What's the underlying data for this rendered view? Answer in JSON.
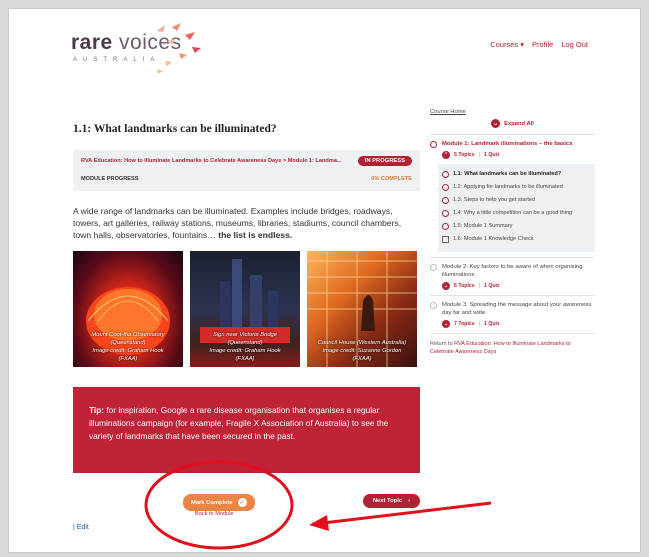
{
  "header": {
    "logo_word_bold": "rare",
    "logo_word": "voices",
    "logo_sub": "AUSTRALIA",
    "nav": {
      "courses": "Courses ▾",
      "profile": "Profile",
      "logout": "Log Out"
    }
  },
  "lesson": {
    "title": "1.1: What landmarks can be illuminated?",
    "breadcrumb": "RVA Education: How to Illuminate Landmarks to Celebrate Awareness Days > Module 1: Landma...",
    "status": "IN PROGRESS",
    "progress_label": "MODULE PROGRESS",
    "progress_value": "0% COMPLETE",
    "intro": "A wide range of landmarks can be illuminated. Examples include bridges, roadways, towers, art galleries, railway stations, museums, libraries, stadiums, council chambers, town halls, observatories, fountains…",
    "intro_bold": "the list is endless.",
    "photos": [
      {
        "caption_line1": "Mount Coot-tha Observatory",
        "caption_line2": "(Queensland)",
        "caption_line3": "Image credit: Graham Hook",
        "caption_line4": "(FXAA)"
      },
      {
        "caption_line1": "Sign near Victoria Bridge",
        "caption_line2": "(Queensland)",
        "caption_line3": "Image credit: Graham Hook",
        "caption_line4": "(FXAA)"
      },
      {
        "caption_line1": "Council House (Western Australia)",
        "caption_line2": "Image credit: Suzanne Gordon",
        "caption_line3": "(FXAA)",
        "caption_line4": ""
      }
    ],
    "tip_label": "Tip:",
    "tip_text": "for inspiration, Google a rare disease organisation that organises a regular illuminations campaign (for example, Fragile X Association of Australia) to see the variety of landmarks that have been secured in the past.",
    "mark_complete": "Mark Complete",
    "back_to_module": "Back to Module",
    "next_topic": "Next Topic",
    "edit": "| Edit"
  },
  "sidebar": {
    "course_home": "Course Home",
    "expand_all": "Expand All",
    "modules": [
      {
        "title": "Module 1: Landmark illuminations – the basics",
        "topics": "5 Topics",
        "quiz": "1 Quiz",
        "lessons": [
          "1.1: What landmarks can be illuminated?",
          "1.2: Applying for landmarks to be illuminated",
          "1.3: Steps to help you get started",
          "1.4: Why a little competition can be a good thing",
          "1.5: Module 1 Summary",
          "1.6: Module 1 Knowledge Check"
        ]
      },
      {
        "title": "Module 2: Key factors to be aware of when organising illuminations",
        "topics": "6 Topics",
        "quiz": "1 Quiz"
      },
      {
        "title": "Module 3: Spreading the message about your awareness day far and wide",
        "topics": "7 Topics",
        "quiz": "1 Quiz"
      }
    ],
    "return_prefix": "Return to",
    "return_link": "RVA Education: How to Illuminate Landmarks to Celebrate Awareness Days"
  },
  "colors": {
    "brand_red": "#b32134",
    "tip_red": "#c12336",
    "orange": "#ec8446",
    "annotation_red": "#e0101c"
  }
}
